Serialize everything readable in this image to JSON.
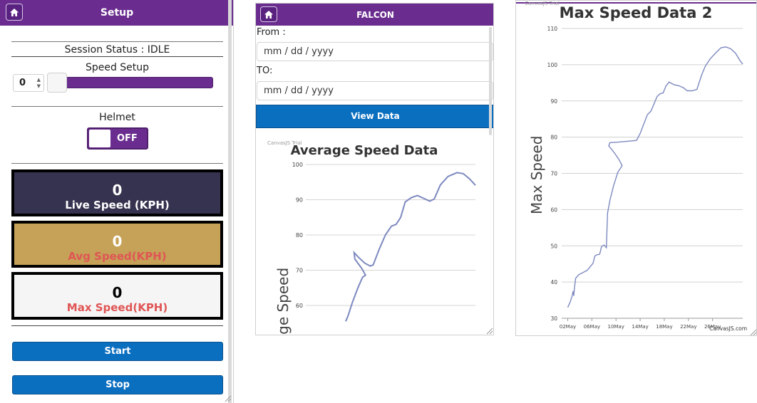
{
  "setup": {
    "title": "Setup",
    "session_status": "Session Status : IDLE",
    "speed_setup_label": "Speed Setup",
    "speed_value": "0",
    "helmet_label": "Helmet",
    "helmet_toggle": "OFF",
    "live": {
      "value": "0",
      "label": "Live Speed (KPH)"
    },
    "avg": {
      "value": "0",
      "label": "Avg Speed(KPH)"
    },
    "max": {
      "value": "0",
      "label": "Max Speed(KPH)"
    },
    "start_label": "Start",
    "stop_label": "Stop",
    "colors": {
      "header": "#6a2d8f",
      "live_bg": "#35334f",
      "avg_bg": "#c5a257",
      "max_bg": "#f5f5f5",
      "red_text": "#e05555",
      "button": "#0b6fc0"
    }
  },
  "falcon": {
    "title": "FALCON",
    "from_label": "From :",
    "from_value": "mm / dd / yyyy",
    "to_label": "TO:",
    "to_value": "mm / dd / yyyy",
    "view_label": "View Data",
    "trial_text": "CanvasJS Trial"
  },
  "max_panel": {
    "trial_text": "CanvasJS Trial",
    "credit_text": "CanvasJS.com"
  },
  "chart_data": [
    {
      "type": "line",
      "title": "Average Speed Data",
      "ylabel": "Average Speed",
      "y_ticks": [
        "60",
        "70",
        "80",
        "90",
        "100"
      ],
      "ylim": [
        54,
        100
      ],
      "color": "#7d89bf",
      "points": [
        [
          0,
          55.5
        ],
        [
          0.3,
          57
        ],
        [
          0.9,
          61
        ],
        [
          1.6,
          65
        ],
        [
          2.2,
          68
        ],
        [
          2.6,
          68.6
        ],
        [
          2.1,
          70.5
        ],
        [
          1.6,
          72
        ],
        [
          1.2,
          73.2
        ],
        [
          1.1,
          75.0
        ],
        [
          1.7,
          73.6
        ],
        [
          2.5,
          72
        ],
        [
          3.2,
          71.2
        ],
        [
          3.6,
          71.5
        ],
        [
          4.4,
          76
        ],
        [
          5.2,
          80
        ],
        [
          6.0,
          82.5
        ],
        [
          6.6,
          83
        ],
        [
          7.2,
          85
        ],
        [
          7.8,
          89.4
        ],
        [
          8.6,
          90.6
        ],
        [
          9.4,
          91.2
        ],
        [
          10.2,
          90.4
        ],
        [
          11.0,
          89.6
        ],
        [
          11.6,
          90.2
        ],
        [
          12.4,
          94.2
        ],
        [
          13.4,
          96.6
        ],
        [
          14.6,
          97.7
        ],
        [
          15.4,
          97.4
        ],
        [
          16.2,
          96.0
        ],
        [
          17.0,
          94.1
        ]
      ]
    },
    {
      "type": "line",
      "title": "Max Speed Data 2",
      "ylabel": "Max Speed",
      "x_ticks": [
        "02May",
        "06May",
        "10May",
        "14May",
        "18May",
        "22May",
        "26May"
      ],
      "y_ticks": [
        "30",
        "40",
        "50",
        "60",
        "70",
        "80",
        "90",
        "100",
        "110"
      ],
      "xlim": [
        1,
        31
      ],
      "ylim": [
        30,
        110
      ],
      "color": "#7d89bf",
      "points": [
        [
          2.0,
          33
        ],
        [
          2.4,
          34.5
        ],
        [
          2.7,
          36
        ],
        [
          2.9,
          37.5
        ],
        [
          3.0,
          36.2
        ],
        [
          3.1,
          38.2
        ],
        [
          3.3,
          41
        ],
        [
          3.8,
          42
        ],
        [
          4.5,
          42.6
        ],
        [
          5.2,
          43.2
        ],
        [
          5.7,
          44.2
        ],
        [
          6.2,
          45.2
        ],
        [
          6.5,
          47.2
        ],
        [
          6.8,
          47.5
        ],
        [
          7.3,
          47.7
        ],
        [
          7.6,
          49.8
        ],
        [
          8.0,
          50.2
        ],
        [
          8.4,
          49.5
        ],
        [
          8.6,
          59
        ],
        [
          9.0,
          62.6
        ],
        [
          9.6,
          66.6
        ],
        [
          10.3,
          70.3
        ],
        [
          10.9,
          71.8
        ],
        [
          11.0,
          72.2
        ],
        [
          10.5,
          73.8
        ],
        [
          9.8,
          75.5
        ],
        [
          9.2,
          76.8
        ],
        [
          8.8,
          77.6
        ],
        [
          9.0,
          78.5
        ],
        [
          10.2,
          78.6
        ],
        [
          11.6,
          78.8
        ],
        [
          12.8,
          79.0
        ],
        [
          13.4,
          79.1
        ],
        [
          14.0,
          81
        ],
        [
          14.6,
          83.6
        ],
        [
          15.2,
          86.2
        ],
        [
          15.8,
          87.2
        ],
        [
          16.3,
          89.2
        ],
        [
          16.8,
          91.2
        ],
        [
          17.3,
          92
        ],
        [
          17.8,
          92.2
        ],
        [
          18.3,
          94.2
        ],
        [
          18.8,
          95.2
        ],
        [
          19.6,
          94.5
        ],
        [
          20.4,
          94.2
        ],
        [
          21.2,
          93.6
        ],
        [
          21.8,
          92.8
        ],
        [
          22.6,
          92.8
        ],
        [
          23.4,
          93.2
        ],
        [
          24.2,
          97.2
        ],
        [
          24.8,
          99.6
        ],
        [
          25.6,
          101.6
        ],
        [
          26.6,
          103.4
        ],
        [
          27.4,
          104.7
        ],
        [
          28.2,
          104.9
        ],
        [
          29.0,
          104.4
        ],
        [
          29.8,
          103.2
        ],
        [
          30.6,
          101.0
        ],
        [
          31.0,
          100.2
        ]
      ]
    }
  ]
}
